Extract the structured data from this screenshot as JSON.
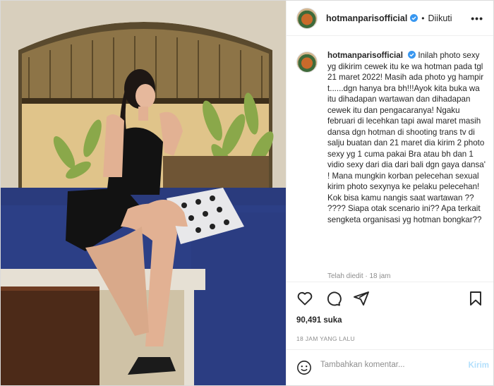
{
  "header": {
    "username": "hotmanparisofficial",
    "separator": "•",
    "follow_status": "Diikuti",
    "more": "•••"
  },
  "caption": {
    "username": "hotmanparisofficial",
    "text": "Inilah photo sexy yg dikirim cewek itu ke wa hotman pada tgl 21 maret 2022! Masih ada photo yg hampir t......dgn hanya bra bh!!!Ayok kita buka wa itu dihadapan wartawan dan dihadapan cewek itu dan pengacaranya! Ngaku februari di lecehkan tapi awal maret masih dansa dgn hotman di shooting trans tv di salju buatan dan 21 maret dia kirim 2 photo sexy yg 1 cuma pakai Bra atau bh dan 1 vidio sexy dari dia dari bali dgn gaya dansa' ! Mana mungkin korban pelecehan sexual kirim photo sexynya ke pelaku pelecehan! Kok bisa kamu nangis saat wartawan ?? ???? Siapa otak scenario ini?? Apa terkait sengketa organisasi yg hotman bongkar??",
    "edited_note": "Telah diedit · 18 jam"
  },
  "likes": "90,491 suka",
  "time_ago": "18 JAM YANG LALU",
  "comment": {
    "placeholder": "Tambahkan komentar...",
    "submit": "Kirim"
  },
  "icons": [
    "heart-icon",
    "comment-icon",
    "share-icon",
    "bookmark-icon",
    "emoji-icon",
    "verified-icon"
  ],
  "colors": {
    "verified": "#3897f0",
    "submit_disabled": "#b2dffc",
    "muted": "#8e8e8e"
  }
}
